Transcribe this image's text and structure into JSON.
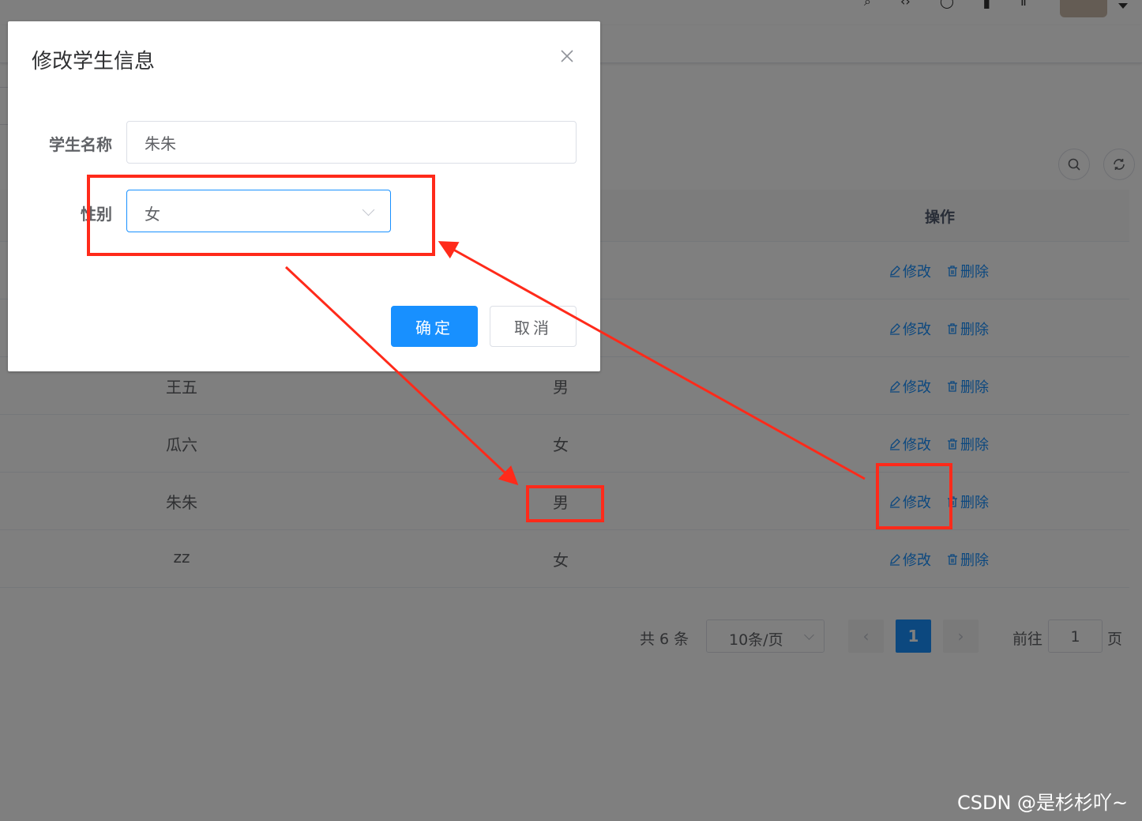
{
  "table": {
    "ops_header": "操作",
    "rows": [
      {
        "name": "",
        "sex": ""
      },
      {
        "name": "",
        "sex": ""
      },
      {
        "name": "王五",
        "sex": "男"
      },
      {
        "name": "瓜六",
        "sex": "女"
      },
      {
        "name": "朱朱",
        "sex": "男"
      },
      {
        "name": "zz",
        "sex": "女"
      }
    ],
    "edit_label": "修改",
    "delete_label": "删除"
  },
  "pagination": {
    "total": "共 6 条",
    "page_size": "10条/页",
    "current_page": "1",
    "goto_label": "前往",
    "goto_value": "1",
    "page_suffix": "页"
  },
  "dialog": {
    "title": "修改学生信息",
    "name_label": "学生名称",
    "name_value": "朱朱",
    "sex_label": "性别",
    "sex_value": "女",
    "ok_label": "确定",
    "cancel_label": "取消"
  },
  "colors": {
    "primary": "#1890ff",
    "annotation": "#ff2a1a"
  },
  "watermark": "CSDN @是杉杉吖~"
}
